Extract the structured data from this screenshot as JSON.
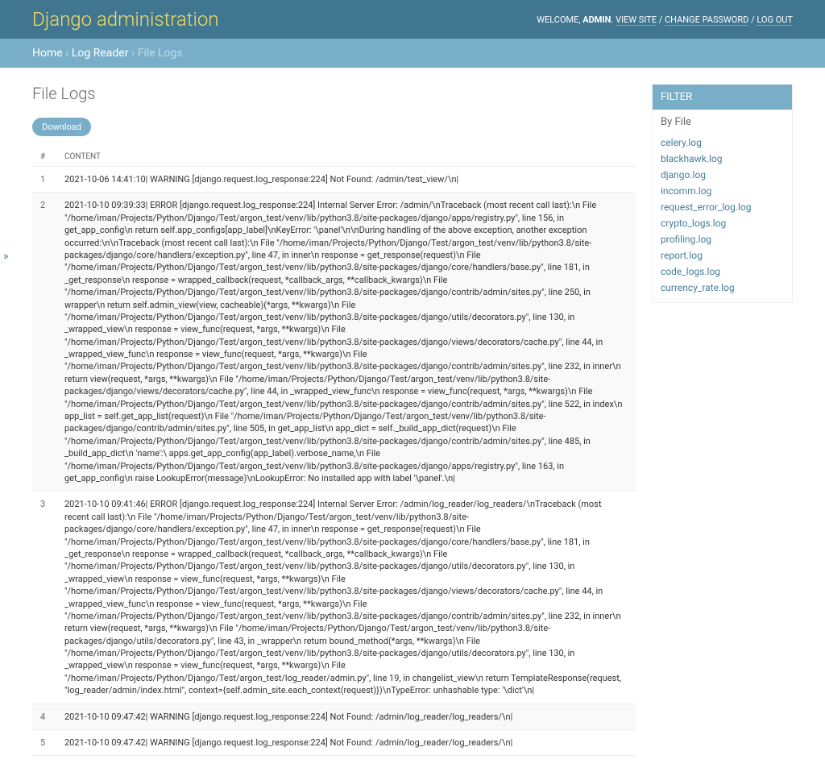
{
  "header": {
    "branding": "Django administration",
    "welcome_prefix": "WELCOME, ",
    "username": "ADMIN",
    "view_site": "VIEW SITE",
    "change_password": "CHANGE PASSWORD",
    "log_out": "LOG OUT",
    "sep": " / ",
    "dot": ". "
  },
  "breadcrumbs": {
    "home": "Home",
    "app": "Log Reader",
    "current": "File Logs",
    "sep": " › "
  },
  "page": {
    "title": "File Logs",
    "download": "Download"
  },
  "table": {
    "col_num": "#",
    "col_content": "CONTENT",
    "rows": [
      {
        "n": "1",
        "c": "2021-10-06 14:41:10| WARNING [django.request.log_response:224] Not Found: /admin/test_view/\\n|"
      },
      {
        "n": "2",
        "c": "2021-10-10 09:39:33| ERROR [django.request.log_response:224] Internal Server Error: /admin/\\nTraceback (most recent call last):\\n File \"/home/iman/Projects/Python/Django/Test/argon_test/venv/lib/python3.8/site-packages/django/apps/registry.py\", line 156, in get_app_config\\n return self.app_configs[app_label]\\nKeyError: '\\panel'\\n\\nDuring handling of the above exception, another exception occurred:\\n\\nTraceback (most recent call last):\\n File \"/home/iman/Projects/Python/Django/Test/argon_test/venv/lib/python3.8/site-packages/django/core/handlers/exception.py\", line 47, in inner\\n response = get_response(request)\\n File \"/home/iman/Projects/Python/Django/Test/argon_test/venv/lib/python3.8/site-packages/django/core/handlers/base.py\", line 181, in _get_response\\n response = wrapped_callback(request, *callback_args, **callback_kwargs)\\n File \"/home/iman/Projects/Python/Django/Test/argon_test/venv/lib/python3.8/site-packages/django/contrib/admin/sites.py\", line 250, in wrapper\\n return self.admin_view(view, cacheable)(*args, **kwargs)\\n File \"/home/iman/Projects/Python/Django/Test/argon_test/venv/lib/python3.8/site-packages/django/utils/decorators.py\", line 130, in _wrapped_view\\n response = view_func(request, *args, **kwargs)\\n File \"/home/iman/Projects/Python/Django/Test/argon_test/venv/lib/python3.8/site-packages/django/views/decorators/cache.py\", line 44, in _wrapped_view_func\\n response = view_func(request, *args, **kwargs)\\n File \"/home/iman/Projects/Python/Django/Test/argon_test/venv/lib/python3.8/site-packages/django/contrib/admin/sites.py\", line 232, in inner\\n return view(request, *args, **kwargs)\\n File \"/home/iman/Projects/Python/Django/Test/argon_test/venv/lib/python3.8/site-packages/django/views/decorators/cache.py\", line 44, in _wrapped_view_func\\n response = view_func(request, *args, **kwargs)\\n File \"/home/iman/Projects/Python/Django/Test/argon_test/venv/lib/python3.8/site-packages/django/contrib/admin/sites.py\", line 522, in index\\n app_list = self.get_app_list(request)\\n File \"/home/iman/Projects/Python/Django/Test/argon_test/venv/lib/python3.8/site-packages/django/contrib/admin/sites.py\", line 505, in get_app_list\\n app_dict = self._build_app_dict(request)\\n File \"/home/iman/Projects/Python/Django/Test/argon_test/venv/lib/python3.8/site-packages/django/contrib/admin/sites.py\", line 485, in _build_app_dict\\n 'name':\\ apps.get_app_config(app_label).verbose_name,\\n File \"/home/iman/Projects/Python/Django/Test/argon_test/venv/lib/python3.8/site-packages/django/apps/registry.py\", line 163, in get_app_config\\n raise LookupError(message)\\nLookupError: No installed app with label '\\panel'.\\n|"
      },
      {
        "n": "3",
        "c": "2021-10-10 09:41:46| ERROR [django.request.log_response:224] Internal Server Error: /admin/log_reader/log_readers/\\nTraceback (most recent call last):\\n File \"/home/iman/Projects/Python/Django/Test/argon_test/venv/lib/python3.8/site-packages/django/core/handlers/exception.py\", line 47, in inner\\n response = get_response(request)\\n File \"/home/iman/Projects/Python/Django/Test/argon_test/venv/lib/python3.8/site-packages/django/core/handlers/base.py\", line 181, in _get_response\\n response = wrapped_callback(request, *callback_args, **callback_kwargs)\\n File \"/home/iman/Projects/Python/Django/Test/argon_test/venv/lib/python3.8/site-packages/django/utils/decorators.py\", line 130, in _wrapped_view\\n response = view_func(request, *args, **kwargs)\\n File \"/home/iman/Projects/Python/Django/Test/argon_test/venv/lib/python3.8/site-packages/django/views/decorators/cache.py\", line 44, in _wrapped_view_func\\n response = view_func(request, *args, **kwargs)\\n File \"/home/iman/Projects/Python/Django/Test/argon_test/venv/lib/python3.8/site-packages/django/contrib/admin/sites.py\", line 232, in inner\\n return view(request, *args, **kwargs)\\n File \"/home/iman/Projects/Python/Django/Test/argon_test/venv/lib/python3.8/site-packages/django/utils/decorators.py\", line 43, in _wrapper\\n return bound_method(*args, **kwargs)\\n File \"/home/iman/Projects/Python/Django/Test/argon_test/venv/lib/python3.8/site-packages/django/utils/decorators.py\", line 130, in _wrapped_view\\n response = view_func(request, *args, **kwargs)\\n File \"/home/iman/Projects/Python/Django/Test/argon_test/log_reader/admin.py\", line 19, in changelist_view\\n return TemplateResponse(request, \"log_reader/admin/index.html\", context={self.admin_site.each_context(request)})\\nTypeError: unhashable type: '\\dict'\\n|"
      },
      {
        "n": "4",
        "c": "2021-10-10 09:47:42| WARNING [django.request.log_response:224] Not Found: /admin/log_reader/log_readers/\\n|"
      },
      {
        "n": "5",
        "c": "2021-10-10 09:47:42| WARNING [django.request.log_response:224] Not Found: /admin/log_reader/log_readers/\\n|"
      }
    ]
  },
  "filter": {
    "title": "FILTER",
    "by_file": "By File",
    "items": [
      "celery.log",
      "blackhawk.log",
      "django.log",
      "incomm.log",
      "request_error_log.log",
      "crypto_logs.log",
      "profiling.log",
      "report.log",
      "code_logs.log",
      "currency_rate.log"
    ]
  },
  "page_arrow": "»"
}
